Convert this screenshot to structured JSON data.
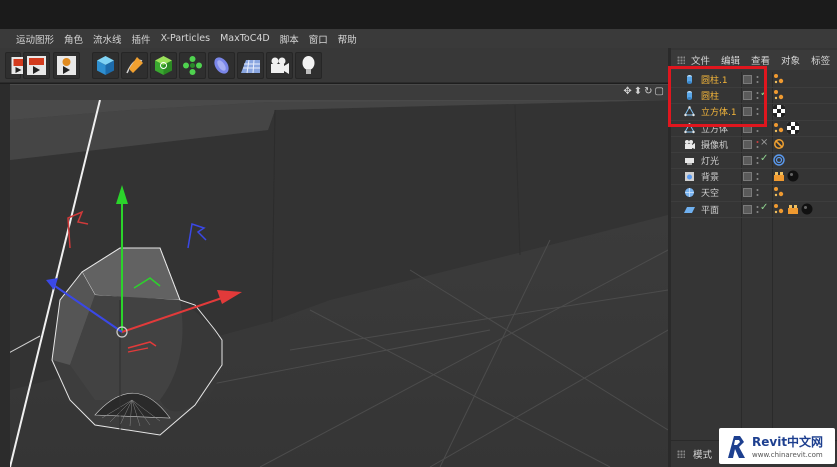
{
  "menubar": {
    "items": [
      "运动图形",
      "角色",
      "流水线",
      "插件",
      "X-Particles",
      "MaxToC4D",
      "脚本",
      "窗口",
      "帮助"
    ]
  },
  "toolbar": {
    "buttons": [
      "render-settings-icon",
      "render-picture-viewer-icon",
      "render-queue-icon",
      "cube-icon",
      "pen-spline-icon",
      "subdivision-icon",
      "array-icon",
      "deformer-icon",
      "floor-grid-icon",
      "camera-icon",
      "light-icon"
    ]
  },
  "viewport": {
    "nav_icons": [
      "move-view-icon",
      "pan-down-icon",
      "rotate-view-icon",
      "maximize-view-icon"
    ]
  },
  "object_manager": {
    "menu": [
      "文件",
      "编辑",
      "查看",
      "对象",
      "标签"
    ],
    "objects": [
      {
        "name": "圆柱.1",
        "selected": true,
        "icon": "cylinder-icon",
        "tags": [
          "texture-tag",
          "texture-tag"
        ]
      },
      {
        "name": "圆柱",
        "selected": true,
        "icon": "cylinder-icon",
        "tags": [
          "texture-tag"
        ]
      },
      {
        "name": "立方体.1",
        "selected": true,
        "icon": "cube-poly-icon",
        "tags": [
          "checker-tag"
        ]
      },
      {
        "name": "立方体",
        "selected": false,
        "icon": "cube-poly-icon",
        "tags": [
          "texture-tag",
          "checker-tag"
        ]
      },
      {
        "name": "摄像机",
        "selected": false,
        "icon": "camera-object-icon",
        "tags": [
          "no-render-tag"
        ]
      },
      {
        "name": "灯光",
        "selected": false,
        "icon": "light-object-icon",
        "tags": [
          "target-tag"
        ]
      },
      {
        "name": "背景",
        "selected": false,
        "icon": "background-object-icon",
        "tags": [
          "texture-tag",
          "sphere-material-tag"
        ]
      },
      {
        "name": "天空",
        "selected": false,
        "icon": "sky-object-icon",
        "tags": [
          "texture-tag"
        ]
      },
      {
        "name": "平面",
        "selected": false,
        "icon": "plane-object-icon",
        "tags": [
          "texture-tag",
          "texture-tag",
          "sphere-material-tag"
        ]
      }
    ],
    "bottom_tab": "模式"
  },
  "watermark": {
    "title": "Revit中文网",
    "url": "www.chinarevit.com"
  },
  "colors": {
    "selected_text": "#f5b63a",
    "highlight_box": "#e0161e",
    "axis_x": "#e23a3a",
    "axis_y": "#2bd42b",
    "axis_z": "#3a48e6"
  }
}
